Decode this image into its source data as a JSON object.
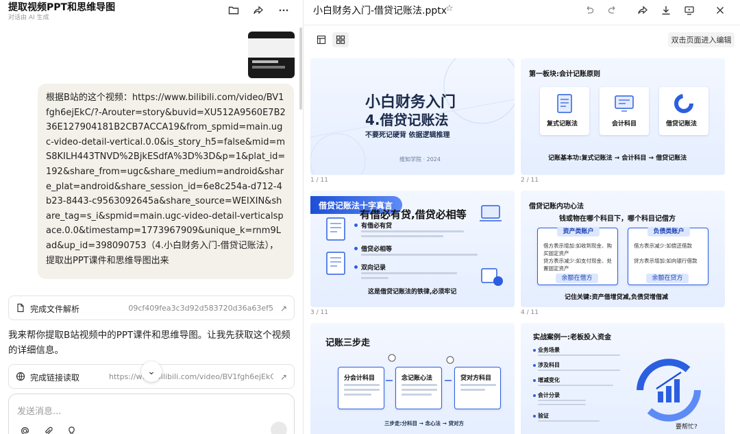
{
  "chat": {
    "title": "提取视频PPT和思维导图",
    "subtitle": "对话由 AI 生成",
    "header_icons": [
      "folder-icon",
      "share-icon",
      "more-icon"
    ],
    "user_message": "根据B站的这个视频：https://www.bilibili.com/video/BV1fgh6ejEkC/?-Arouter=story&buvid=XU512A9560E7B236E127904181B2CB7ACCA19&from_spmid=main.ugc-video-detail-vertical.0.0&is_story_h5=false&mid=mS8KILH443TNVD%2BjkESdfA%3D%3D&p=1&plat_id=192&share_from=ugc&share_medium=android&share_plat=android&share_session_id=6e8c254a-d712-4b23-8443-c9563092645a&share_source=WEIXIN&share_tag=s_i&spmid=main.ugc-video-detail-verticalspace.0.0&timestamp=1773967909&unique_k=rnm9Lad&up_id=398090753（4.小白财务入门-借贷记账法），提取出PPT课件和思维导图出来",
    "file_card": {
      "label": "完成文件解析",
      "value": "09cf409fea3c3d92d583720d36a63ef5"
    },
    "assistant_message": "我来帮你提取B站视频中的PPT课件和思维导图。让我先获取这个视频的详细信息。",
    "link_card": {
      "label": "完成链接读取",
      "value": "https://www.bilibili.com/video/BV1fgh6ejEkC"
    },
    "input_placeholder": "发送消息...",
    "input_tools": [
      "at-icon",
      "paperclip-icon",
      "lightbulb-icon"
    ]
  },
  "preview": {
    "file_title": "小白财务入门-借贷记账法.pptx",
    "toolbar_icons": [
      "undo-icon",
      "redo-icon",
      "share-icon",
      "download-icon",
      "present-icon",
      "close-icon"
    ],
    "edit_hint": "双击页面进入编辑",
    "slides": [
      {
        "num": "1 / 11",
        "title": "小白财务入门",
        "subtitle": "4.借贷记账法",
        "tagline": "不要死记硬背 依据逻辑推理",
        "footer": "维知学院 · 2024"
      },
      {
        "num": "2 / 11",
        "heading": "第一板块:会计记账原则",
        "cards": [
          "复式记账法",
          "会计科目",
          "借贷记账法"
        ],
        "footer": "记账基本功:复式记账法 → 会计科目 → 借贷记账法"
      },
      {
        "num": "3 / 11",
        "heading": "借贷记账法十字真言",
        "title": "有借必有贷,借贷必相等",
        "points": [
          "有借必有贷",
          "借贷必相等",
          "双向记录"
        ],
        "footer": "这是借贷记账法的铁律,必须牢记"
      },
      {
        "num": "4 / 11",
        "heading": "借贷记账内功心法",
        "title": "钱或物在哪个科目下，哪个科目记借方",
        "left": {
          "label": "资产类账户",
          "rows": [
            "借方表示增加:如收到现金、购买固定资产",
            "贷方表示减少:如支付现金、处置固定资产"
          ],
          "pill": "余额在借方"
        },
        "right": {
          "label": "负债类账户",
          "rows": [
            "借方表示减少:如偿还借款",
            "贷方表示增加:如向银行借款"
          ],
          "pill": "余额在贷方"
        },
        "footer": "记住关键:资产借增贷减,负债贷增借减"
      },
      {
        "num": "",
        "heading": "记账三步走",
        "steps": [
          "分会计科目",
          "念记账心法",
          "贷对方科目"
        ],
        "footer": "三步走:分科目 → 念心法 → 贷对方"
      },
      {
        "num": "",
        "heading": "实战案例一:老板投入资金",
        "items": [
          "业务场景",
          "涉及科目",
          "增减变化",
          "会计分录",
          "验证"
        ],
        "help": "要帮忙?"
      }
    ]
  }
}
